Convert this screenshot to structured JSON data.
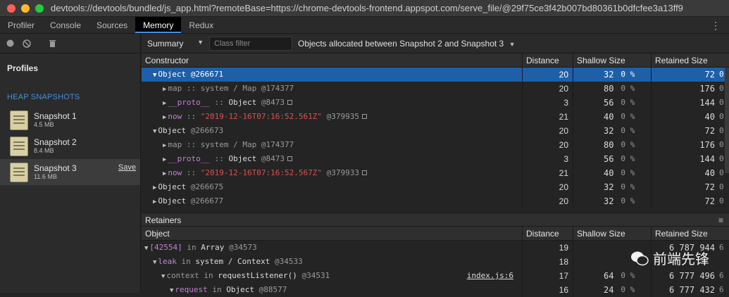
{
  "window": {
    "title": "devtools://devtools/bundled/js_app.html?remoteBase=https://chrome-devtools-frontend.appspot.com/serve_file/@29f75ce3f42b007bd80361b0dfcfee3a13ff9",
    "dot_colors": [
      "#ff5f57",
      "#febc2e",
      "#28c840"
    ]
  },
  "tabs": [
    "Profiler",
    "Console",
    "Sources",
    "Memory",
    "Redux"
  ],
  "active_tab": "Memory",
  "kebab": "⋮",
  "sidebar": {
    "profiles_label": "Profiles",
    "heap_label": "HEAP SNAPSHOTS",
    "save_label": "Save",
    "snapshots": [
      {
        "name": "Snapshot 1",
        "size": "4.5 MB"
      },
      {
        "name": "Snapshot 2",
        "size": "8.4 MB"
      },
      {
        "name": "Snapshot 3",
        "size": "11.6 MB"
      }
    ]
  },
  "toolbar": {
    "view": "Summary",
    "filter_placeholder": "Class filter",
    "scope": "Objects allocated between Snapshot 2 and Snapshot 3"
  },
  "table": {
    "headers": [
      "Constructor",
      "Distance",
      "Shallow Size",
      "Retained Size"
    ],
    "rows": [
      {
        "indent": 0,
        "expanded": true,
        "selected": true,
        "prefix": "",
        "name": "Object",
        "sep": "",
        "type": "",
        "id": "@266671",
        "distance": "20",
        "shallow": "32",
        "shallow_pct": "0 %",
        "retained": "72",
        "retained_pct": "0"
      },
      {
        "indent": 1,
        "expanded": false,
        "prefix": "map",
        "prefix_kind": "sys",
        "sep": " :: ",
        "name": "system / Map",
        "name_kind": "sys",
        "id": "@174377",
        "distance": "20",
        "shallow": "80",
        "shallow_pct": "0 %",
        "retained": "176",
        "retained_pct": "0"
      },
      {
        "indent": 1,
        "expanded": false,
        "prefix": "__proto__",
        "prefix_kind": "prop",
        "sep": " :: ",
        "name": "Object",
        "name_kind": "obj",
        "id": "@8473",
        "sq": true,
        "distance": "3",
        "shallow": "56",
        "shallow_pct": "0 %",
        "retained": "144",
        "retained_pct": "0"
      },
      {
        "indent": 1,
        "expanded": false,
        "prefix": "now",
        "prefix_kind": "prop",
        "sep": " :: ",
        "name": "\"2019-12-16T07:16:52.561Z\"",
        "name_kind": "red",
        "id": "@379935",
        "sq": true,
        "distance": "21",
        "shallow": "40",
        "shallow_pct": "0 %",
        "retained": "40",
        "retained_pct": "0"
      },
      {
        "indent": 0,
        "expanded": true,
        "prefix": "",
        "name": "Object",
        "sep": "",
        "id": "@266673",
        "distance": "20",
        "shallow": "32",
        "shallow_pct": "0 %",
        "retained": "72",
        "retained_pct": "0"
      },
      {
        "indent": 1,
        "expanded": false,
        "prefix": "map",
        "prefix_kind": "sys",
        "sep": " :: ",
        "name": "system / Map",
        "name_kind": "sys",
        "id": "@174377",
        "distance": "20",
        "shallow": "80",
        "shallow_pct": "0 %",
        "retained": "176",
        "retained_pct": "0"
      },
      {
        "indent": 1,
        "expanded": false,
        "prefix": "__proto__",
        "prefix_kind": "prop",
        "sep": " :: ",
        "name": "Object",
        "name_kind": "obj",
        "id": "@8473",
        "sq": true,
        "distance": "3",
        "shallow": "56",
        "shallow_pct": "0 %",
        "retained": "144",
        "retained_pct": "0"
      },
      {
        "indent": 1,
        "expanded": false,
        "prefix": "now",
        "prefix_kind": "prop",
        "sep": " :: ",
        "name": "\"2019-12-16T07:16:52.567Z\"",
        "name_kind": "red",
        "id": "@379933",
        "sq": true,
        "distance": "21",
        "shallow": "40",
        "shallow_pct": "0 %",
        "retained": "40",
        "retained_pct": "0"
      },
      {
        "indent": 0,
        "expanded": false,
        "prefix": "",
        "name": "Object",
        "sep": "",
        "id": "@266675",
        "distance": "20",
        "shallow": "32",
        "shallow_pct": "0 %",
        "retained": "72",
        "retained_pct": "0"
      },
      {
        "indent": 0,
        "expanded": false,
        "prefix": "",
        "name": "Object",
        "sep": "",
        "id": "@266677",
        "distance": "20",
        "shallow": "32",
        "shallow_pct": "0 %",
        "retained": "72",
        "retained_pct": "0"
      }
    ]
  },
  "retainers": {
    "title": "Retainers",
    "headers": [
      "Object",
      "Distance",
      "Shallow Size",
      "Retained Size"
    ],
    "rows": [
      {
        "indent": 0,
        "prefix": "[42554]",
        "prefix_kind": "prop",
        "sep": " in ",
        "name": "Array",
        "name_kind": "obj",
        "id": "@34573",
        "distance": "19",
        "shallow": "",
        "shallow_pct": "",
        "retained": "6 787 944",
        "retained_pct": "6"
      },
      {
        "indent": 1,
        "prefix": "leak",
        "prefix_kind": "prop",
        "sep": " in ",
        "name": "system / Context",
        "name_kind": "obj",
        "id": "@34533",
        "distance": "18",
        "shallow": "",
        "shallow_pct": "",
        "retained": "",
        "retained_pct": ""
      },
      {
        "indent": 2,
        "prefix": "context",
        "prefix_kind": "sys",
        "sep": " in ",
        "name": "requestListener()",
        "name_kind": "obj",
        "id": "@34531",
        "link": "index.js:6",
        "distance": "17",
        "shallow": "64",
        "shallow_pct": "0 %",
        "retained": "6 777 496",
        "retained_pct": "6"
      },
      {
        "indent": 3,
        "prefix": "request",
        "prefix_kind": "prop",
        "sep": " in ",
        "name": "Object",
        "name_kind": "obj",
        "id": "@88577",
        "distance": "16",
        "shallow": "24",
        "shallow_pct": "0 %",
        "retained": "6 777 432",
        "retained_pct": "6"
      }
    ]
  },
  "watermark": {
    "text": "前端先锋"
  }
}
